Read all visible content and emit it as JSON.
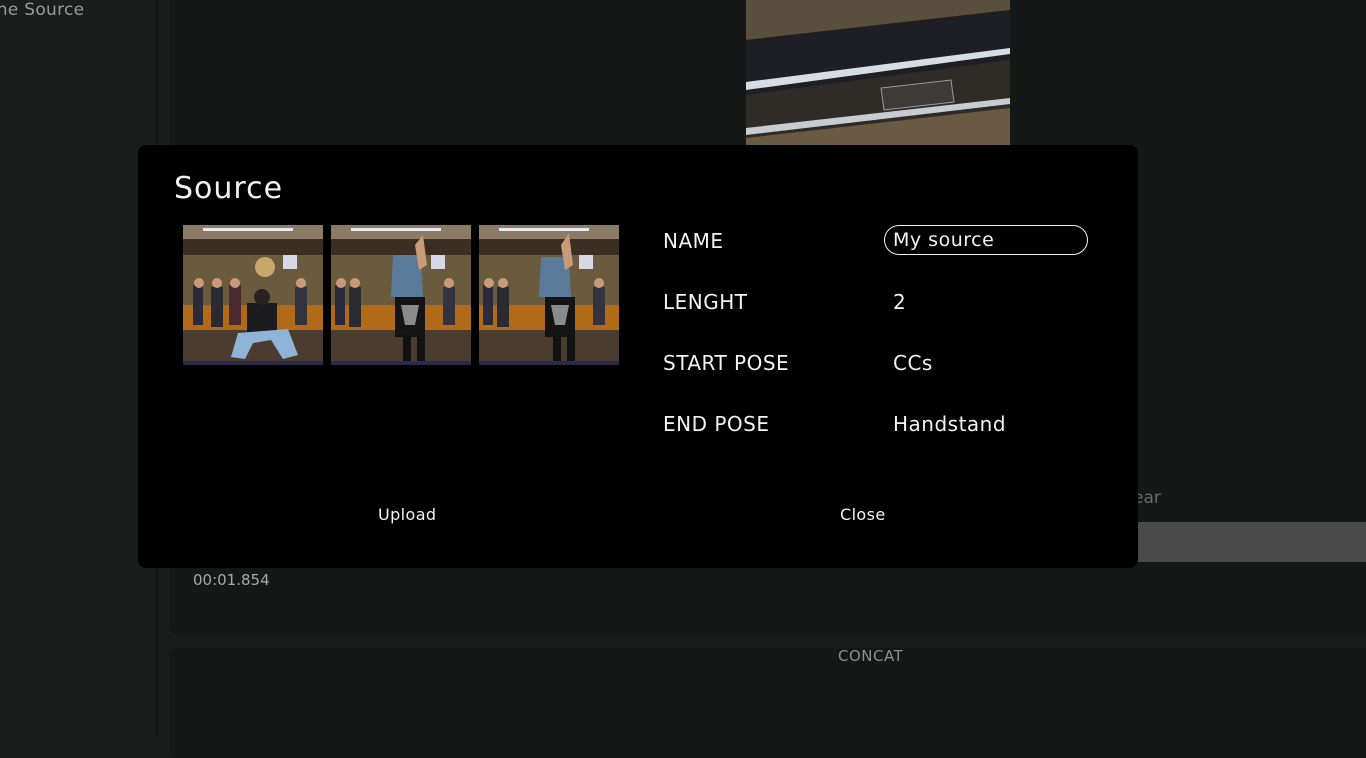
{
  "sidebar": {
    "label": "one Source"
  },
  "background": {
    "clear_label": "ear",
    "timecode": "00:01.854",
    "concat_label": "CONCAT"
  },
  "modal": {
    "title": "Source",
    "fields": {
      "name_label": "NAME",
      "name_value": "My source",
      "length_label": "LENGHT",
      "length_value": "2",
      "start_pose_label": "START POSE",
      "start_pose_value": "CCs",
      "end_pose_label": "END POSE",
      "end_pose_value": "Handstand"
    },
    "buttons": {
      "upload": "Upload",
      "close": "Close"
    }
  }
}
